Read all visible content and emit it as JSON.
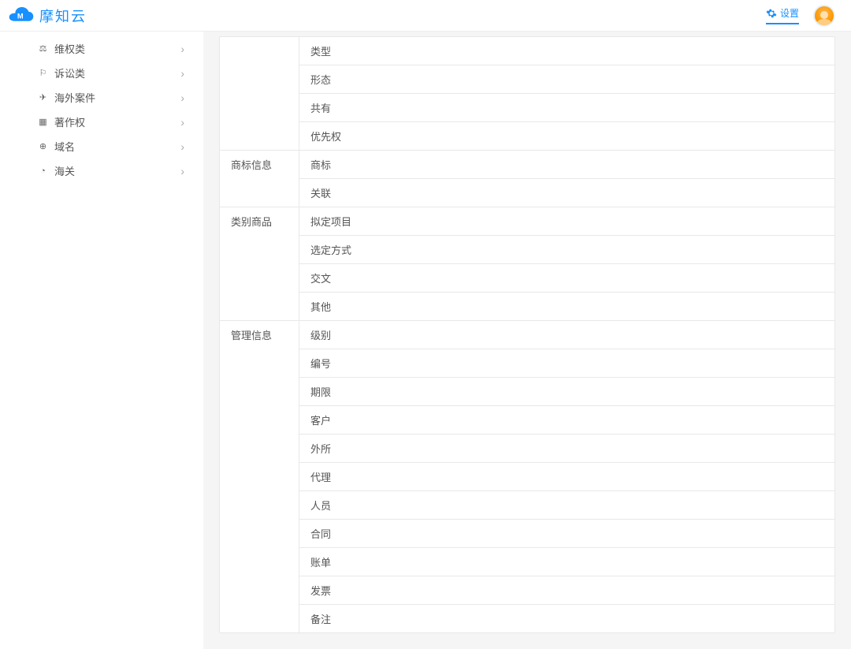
{
  "header": {
    "brand": "摩知云",
    "settings_label": "设置"
  },
  "sidebar": {
    "items": [
      {
        "icon": "gavel",
        "label": "维权类"
      },
      {
        "icon": "scales",
        "label": "诉讼类"
      },
      {
        "icon": "plane",
        "label": "海外案件"
      },
      {
        "icon": "book",
        "label": "著作权"
      },
      {
        "icon": "globe",
        "label": "域名"
      },
      {
        "icon": "clock",
        "label": "海关"
      }
    ]
  },
  "content": {
    "groups": [
      {
        "label": "",
        "rows": [
          "类型",
          "形态",
          "共有",
          "优先权"
        ]
      },
      {
        "label": "商标信息",
        "rows": [
          "商标",
          "关联"
        ]
      },
      {
        "label": "类别商品",
        "rows": [
          "拟定项目",
          "选定方式",
          "交文",
          "其他"
        ]
      },
      {
        "label": "管理信息",
        "rows": [
          "级别",
          "编号",
          "期限",
          "客户",
          "外所",
          "代理",
          "人员",
          "合同",
          "账单",
          "发票",
          "备注"
        ]
      }
    ]
  }
}
